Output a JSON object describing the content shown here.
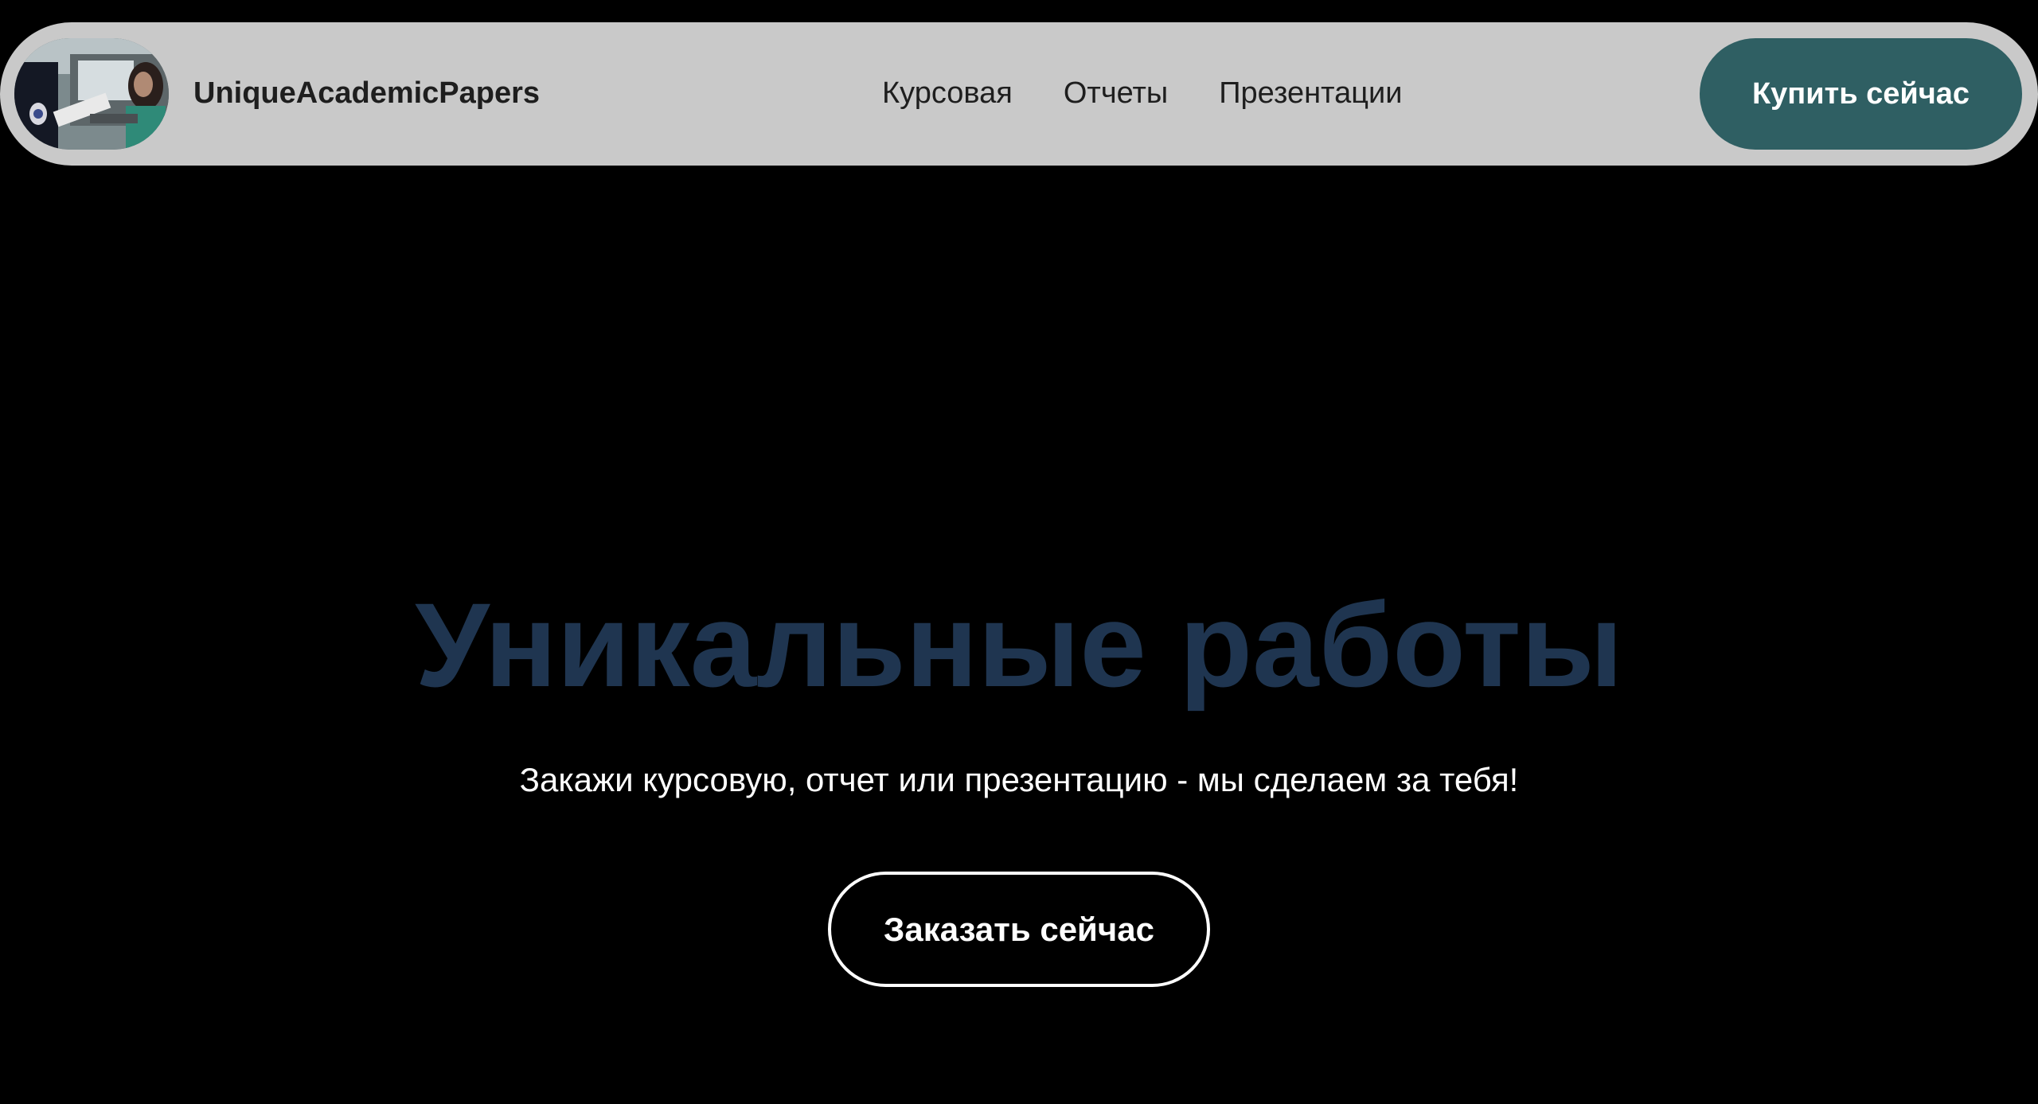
{
  "header": {
    "brand": "UniqueAcademicPapers",
    "logo": "photo-logo",
    "nav": [
      {
        "label": "Курсовая"
      },
      {
        "label": "Отчеты"
      },
      {
        "label": "Презентации"
      }
    ],
    "cta_label": "Купить сейчас"
  },
  "hero": {
    "title": "Уникальные работы",
    "subtitle": "Закажи курсовую, отчет или презентацию - мы сделаем за тебя!",
    "cta_label": "Заказать сейчас"
  },
  "colors": {
    "page_background": "#000000",
    "header_background": "#c9c9c9",
    "header_button": "#2f5f63",
    "hero_title": "#1f3550",
    "text_light": "#ffffff",
    "text_dark": "#1e1e1e"
  }
}
